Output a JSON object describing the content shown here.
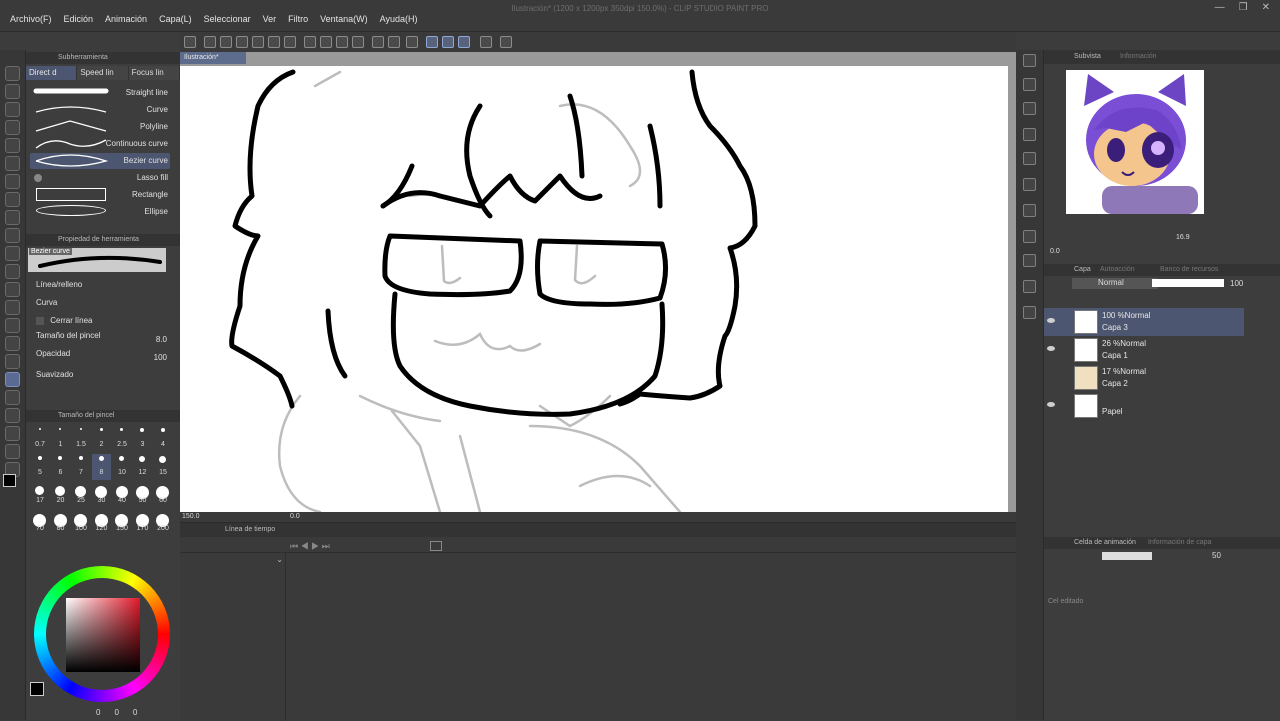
{
  "window": {
    "title": "Ilustración* (1200 x 1200px 350dpi 150.0%) - CLIP STUDIO PAINT PRO"
  },
  "menu": [
    "Archivo(F)",
    "Edición",
    "Animación",
    "Capa(L)",
    "Seleccionar",
    "Ver",
    "Filtro",
    "Ventana(W)",
    "Ayuda(H)"
  ],
  "subtool": {
    "panel_title": "Subherramienta",
    "tabs": [
      "Direct d",
      "Speed lin",
      "Focus lin"
    ],
    "items": [
      "Straight line",
      "Curve",
      "Polyline",
      "Continuous curve",
      "Bezier curve",
      "Lasso fill",
      "Rectangle",
      "Ellipse"
    ],
    "selected": "Bezier curve"
  },
  "tool_property": {
    "panel_title": "Propiedad de herramienta",
    "preview_label": "Bezier curve",
    "line_fill": "Línea/relleno",
    "curve": "Curva",
    "close_line": "Cerrar línea",
    "brush_size_label": "Tamaño del pincel",
    "brush_size_value": "8.0",
    "opacity_label": "Opacidad",
    "opacity_value": "100",
    "smoothing_label": "Suavizado"
  },
  "brush_size_panel": {
    "title": "Tamaño del pincel",
    "row1": [
      "0.7",
      "1",
      "1.5",
      "2",
      "2.5",
      "3",
      "4"
    ],
    "row2": [
      "5",
      "6",
      "7",
      "8",
      "10",
      "12",
      "15"
    ],
    "row3": [
      "17",
      "20",
      "25",
      "30",
      "40",
      "50",
      "60"
    ],
    "row4": [
      "70",
      "80",
      "100",
      "120",
      "150",
      "170",
      "200"
    ],
    "selected": "8"
  },
  "color_bottom": {
    "values": [
      "0",
      "0",
      "0"
    ]
  },
  "colors": {
    "accent": "#5a6a92",
    "fg": "#000000"
  },
  "canvas": {
    "doc_tab": "Ilustración*",
    "zoom": "150.0",
    "rotation": "0.0"
  },
  "timeline": {
    "title": "Línea de tiempo"
  },
  "navigator": {
    "tabs": [
      "Subvista",
      "Información"
    ],
    "zoom": "16.9",
    "rotation": "0.0"
  },
  "layers": {
    "tabs": [
      "Capa",
      "Autoacción",
      "Banco de recursos"
    ],
    "blend_mode": "Normal",
    "opacity": "100",
    "rows": [
      {
        "opacity": "100 %Normal",
        "name": "Capa 3",
        "selected": true
      },
      {
        "opacity": "26 %Normal",
        "name": "Capa 1",
        "selected": false
      },
      {
        "opacity": "17 %Normal",
        "name": "Capa 2",
        "selected": false
      },
      {
        "opacity": "",
        "name": "Papel",
        "selected": false
      }
    ]
  },
  "animation_cels": {
    "tabs": [
      "Celda de animación",
      "Información de capa"
    ],
    "zoom": "50",
    "status": "Cel editado"
  }
}
